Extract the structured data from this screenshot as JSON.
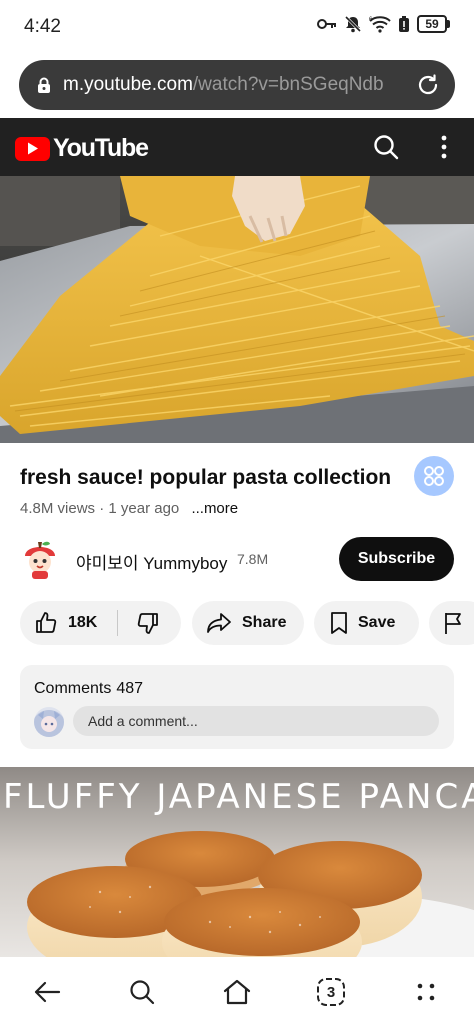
{
  "status_bar": {
    "time": "4:42",
    "battery": "59",
    "icons": [
      "key-icon",
      "mute-bell-icon",
      "wifi-6-icon",
      "battery-saver-icon",
      "battery-icon"
    ]
  },
  "browser": {
    "url_host": "m.youtube.com",
    "url_path": "/watch?v=bnSGeqNdb"
  },
  "youtube": {
    "logo_text": "YouTube",
    "brand_color": "#ff0000"
  },
  "video": {
    "title": "fresh sauce! popular pasta collection",
    "views": "4.8M views",
    "age": "1 year ago",
    "more_label": "...more"
  },
  "channel": {
    "name": "야미보이 Yummyboy",
    "subscribers": "7.8M",
    "subscribe_label": "Subscribe"
  },
  "actions": {
    "likes": "18K",
    "share_label": "Share",
    "save_label": "Save"
  },
  "comments": {
    "label": "Comments",
    "count": "487",
    "placeholder": "Add a comment..."
  },
  "next_video": {
    "title": "FLUFFY JAPANESE PANCAKES"
  },
  "bottom_nav": {
    "tab_count": "3"
  }
}
